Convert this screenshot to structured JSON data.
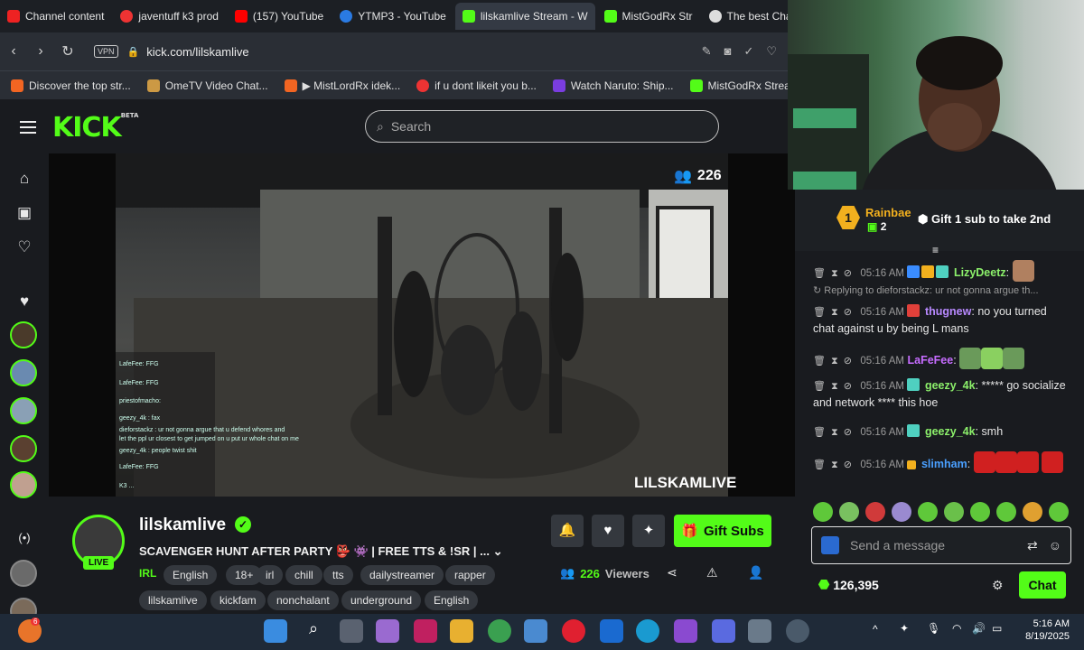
{
  "browser": {
    "tabs": [
      {
        "label": "Channel content",
        "color": "#e22"
      },
      {
        "label": "javentuff k3 prod",
        "color": "#e33"
      },
      {
        "label": "(157) YouTube",
        "color": "#f00"
      },
      {
        "label": "YTMP3 - YouTube",
        "color": "#2a7ae2"
      },
      {
        "label": "lilskamlive Stream - W",
        "color": "#53fc18"
      },
      {
        "label": "MistGodRx Str",
        "color": "#53fc18"
      },
      {
        "label": "The best ChatBo",
        "color": "#ddd"
      }
    ],
    "vpn": "VPN",
    "url": "kick.com/lilskamlive",
    "bookmarks": [
      {
        "label": "Discover the top str...",
        "color": "#f26522"
      },
      {
        "label": "OmeTV Video Chat...",
        "color": "#c94"
      },
      {
        "label": "▶ MistLordRx idek...",
        "color": "#f26522"
      },
      {
        "label": "if u dont likeit you b...",
        "color": "#e33"
      },
      {
        "label": "Watch Naruto: Ship...",
        "color": "#7a3de0"
      },
      {
        "label": "MistGodRx Stream -...",
        "color": "#53fc18"
      }
    ]
  },
  "kick": {
    "logo": "KICK",
    "logo_sup": "BETA",
    "search_placeholder": "Search"
  },
  "video": {
    "viewer_count": "226",
    "watermark": "LILSKAMLIVE",
    "overlay_chat": [
      "LafeFee: FFG",
      "LafeFee: FFG",
      "priestofmacho:",
      "geezy_4k : fax",
      "dieforstackz : ur not gonna argue that u defend whores and",
      "let the ppl ur closest to get jumped on u put ur whole chat on me",
      "geezy_4k : people twist shit",
      "LafeFee: FFG",
      "K3 ..."
    ]
  },
  "stream": {
    "channel": "lilskamlive",
    "live_label": "LIVE",
    "title": "SCAVENGER HUNT AFTER PARTY 👺 👾 | FREE TTS & !SR | ...",
    "category": "IRL",
    "tags_row1": [
      "English",
      "18+",
      "irl",
      "chill",
      "tts",
      "dailystreamer",
      "rapper"
    ],
    "tags_row2": [
      "lilskamlive",
      "kickfam",
      "nonchalant",
      "underground",
      "English"
    ],
    "gift_subs": "Gift Subs",
    "viewers": "226",
    "viewers_label": "Viewers"
  },
  "chat": {
    "gifter_rank": "1",
    "gifter_name": "Rainbae",
    "gifter_count": "2",
    "gift_cta": "Gift 1 sub to take 2nd",
    "reply_context": "Replying to dieforstackz: ur not gonna argue th...",
    "messages": [
      {
        "time": "05:16 AM",
        "user": "LizyDeetz",
        "user_color": "#8cf06b",
        "text": ""
      },
      {
        "time": "05:16 AM",
        "user": "thugnew",
        "user_color": "#b889ff",
        "text": "no you turned chat against u by being L mans"
      },
      {
        "time": "05:16 AM",
        "user": "LaFeFee",
        "user_color": "#c66cff",
        "text": ""
      },
      {
        "time": "05:16 AM",
        "user": "geezy_4k",
        "user_color": "#8cf06b",
        "text": "***** go socialize and network **** this hoe"
      },
      {
        "time": "05:16 AM",
        "user": "geezy_4k",
        "user_color": "#8cf06b",
        "text": "smh"
      },
      {
        "time": "05:16 AM",
        "user": "slimham",
        "user_color": "#4aa0ff",
        "text": ""
      }
    ],
    "input_placeholder": "Send a message",
    "points": "126,395",
    "send_label": "Chat"
  },
  "taskbar": {
    "time": "5:16 AM",
    "date": "8/19/2025",
    "notif_count": "6"
  },
  "colors": {
    "kick_green": "#53fc18",
    "panel_bg": "#191b1f"
  }
}
